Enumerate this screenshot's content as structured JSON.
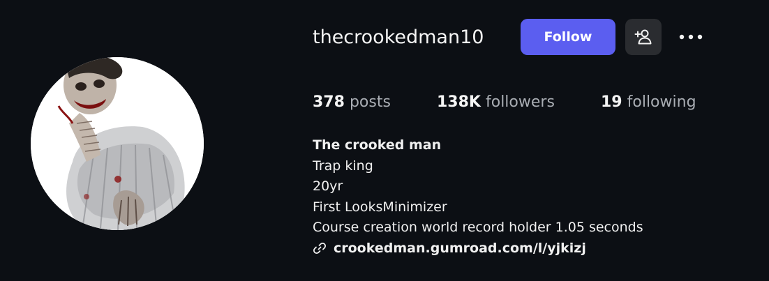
{
  "profile": {
    "username": "thecrookedman10",
    "avatar_icon": "profile-picture-crooked-man-illustration"
  },
  "actions": {
    "follow_label": "Follow",
    "follow_color": "#5b5ef0",
    "suggest_icon": "add-person-icon",
    "more_icon": "more-options-icon"
  },
  "stats": {
    "posts_count": "378",
    "posts_label": "posts",
    "followers_count": "138K",
    "followers_label": "followers",
    "following_count": "19",
    "following_label": "following"
  },
  "bio": {
    "name": "The crooked man",
    "lines": [
      "Trap king",
      "20yr",
      "First LooksMinimizer",
      "Course creation world record holder 1.05 seconds"
    ],
    "link_icon": "link-icon",
    "link": "crookedman.gumroad.com/l/yjkizj"
  }
}
